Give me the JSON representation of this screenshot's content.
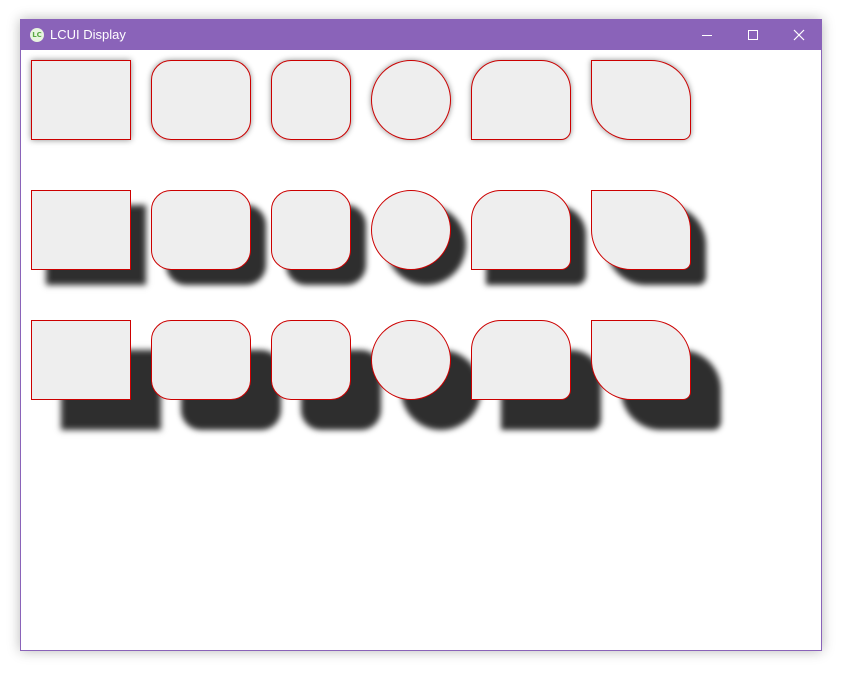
{
  "window": {
    "title": "LCUI Display",
    "app_icon_text": "LC",
    "icon": "lcui-logo-icon",
    "controls": {
      "minimize_icon": "minimize-icon",
      "maximize_icon": "maximize-icon",
      "close_icon": "close-icon"
    },
    "accent_color": "#8a63b9"
  },
  "shapes": {
    "fill_color": "#eeeeee",
    "border_color": "#cc0000",
    "shadow_color": "#333333",
    "rows": [
      {
        "shadow": "blur",
        "items": [
          "square",
          "rounded",
          "rounded-small",
          "circle",
          "rounded-top",
          "leaf"
        ]
      },
      {
        "shadow": "offset",
        "items": [
          "square",
          "rounded",
          "rounded-small",
          "circle",
          "rounded-top",
          "leaf"
        ]
      },
      {
        "shadow": "offset-large",
        "items": [
          "square",
          "rounded",
          "rounded-small",
          "circle",
          "rounded-top",
          "leaf"
        ]
      }
    ]
  }
}
